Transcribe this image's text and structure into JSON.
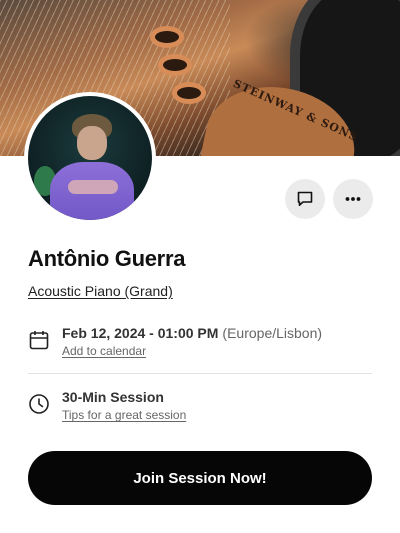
{
  "profile": {
    "name": "Antônio Guerra",
    "instrument": "Acoustic Piano (Grand)"
  },
  "cover": {
    "brand_text": "STEINWAY & SONS"
  },
  "actions": {
    "message_icon": "chat-bubble-icon",
    "more_icon": "more-horizontal-icon"
  },
  "session": {
    "date_time": "Feb 12, 2024 - 01:00 PM",
    "timezone": "(Europe/Lisbon)",
    "add_calendar_label": "Add to calendar",
    "duration_label": "30-Min Session",
    "tips_label": "Tips for a great session"
  },
  "cta": {
    "label": "Join Session Now!"
  },
  "colors": {
    "cta_background": "#060606",
    "icon_button_background": "#ebebeb"
  }
}
